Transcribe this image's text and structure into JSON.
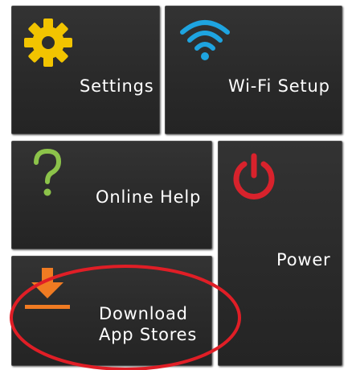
{
  "tiles": {
    "settings": {
      "label": "Settings",
      "icon": "gear-icon"
    },
    "wifi": {
      "label": "Wi-Fi Setup",
      "icon": "wifi-icon"
    },
    "help": {
      "label": "Online Help",
      "icon": "question-mark-icon"
    },
    "power": {
      "label": "Power",
      "icon": "power-icon"
    },
    "download": {
      "label_line1": "Download",
      "label_line2": "App Stores",
      "icon": "download-icon"
    }
  },
  "annotation": {
    "highlight": "download",
    "color": "#e01e26"
  },
  "colors": {
    "tile_bg": "#2b2b2b",
    "gear": "#f2c400",
    "wifi": "#1ea4e0",
    "help": "#8cc34a",
    "power": "#d8222c",
    "download": "#f07b22"
  }
}
